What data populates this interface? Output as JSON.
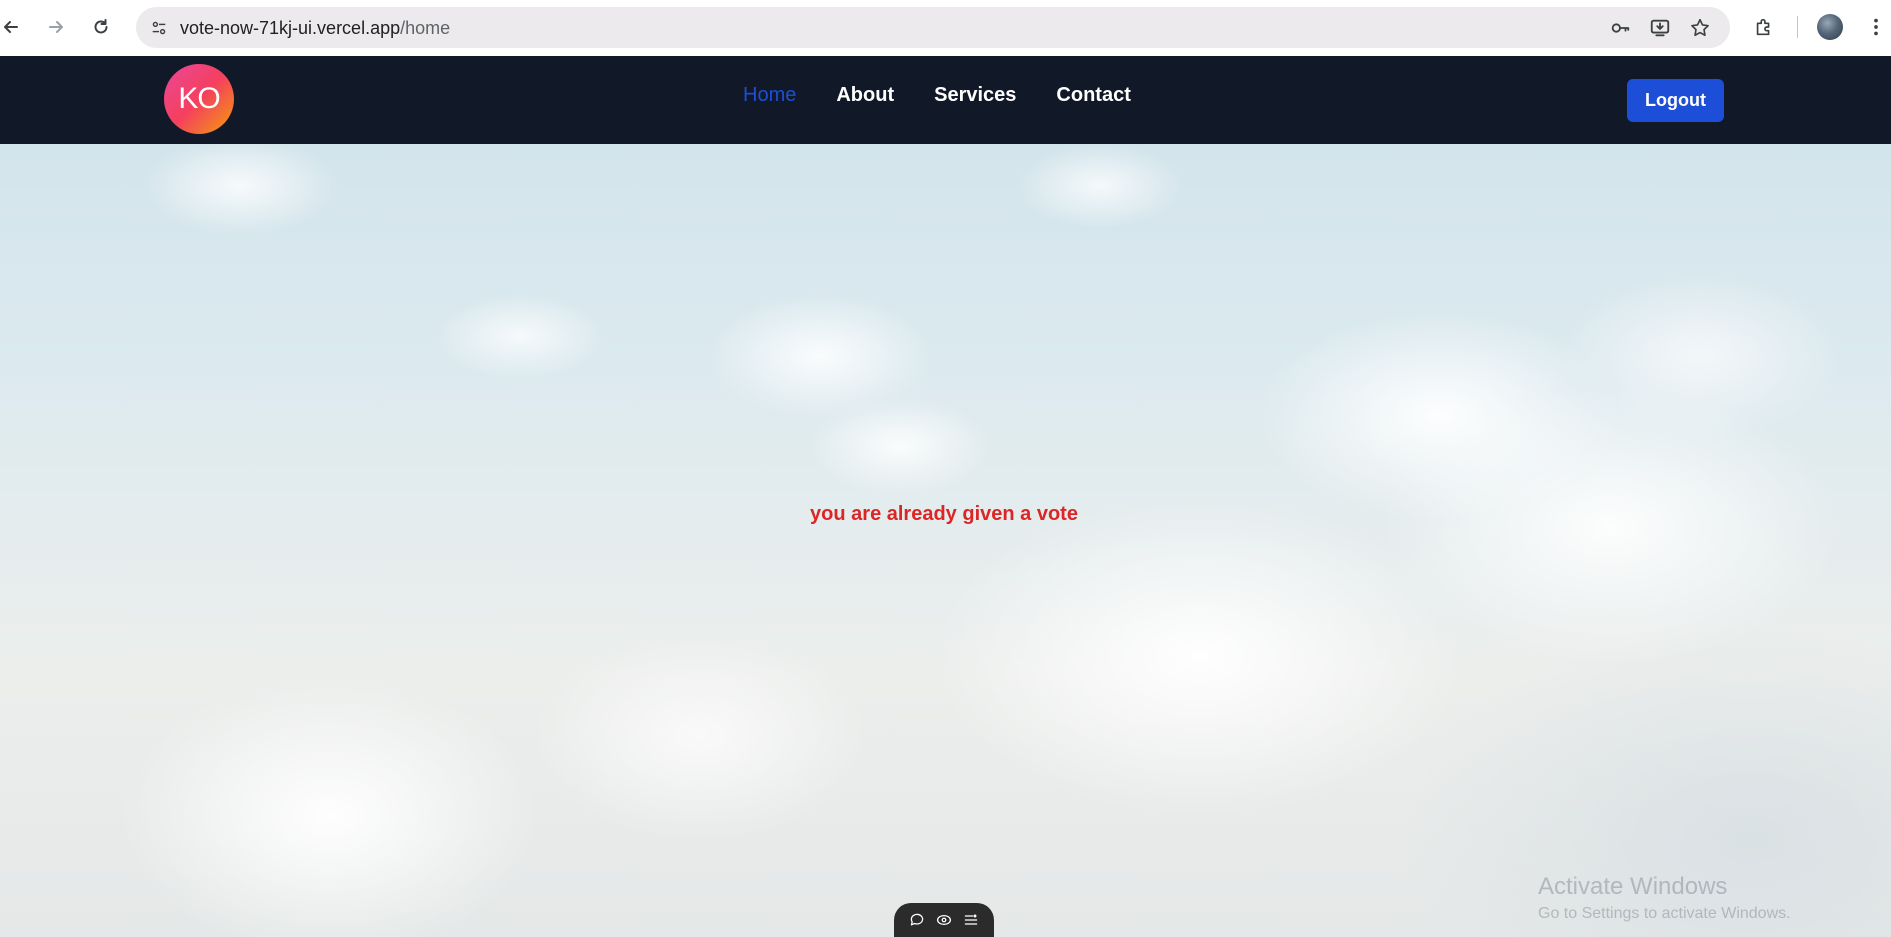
{
  "browser": {
    "url_host": "vote-now-71kj-ui.vercel.app",
    "url_path": "/home",
    "icons": {
      "back": "back-arrow-icon",
      "forward": "forward-arrow-icon",
      "reload": "reload-icon",
      "site_info": "site-settings-icon",
      "password": "key-icon",
      "install": "install-app-icon",
      "bookmark": "star-icon",
      "extensions": "puzzle-icon",
      "menu": "kebab-menu-icon"
    }
  },
  "site": {
    "logo_text": "KO",
    "nav": {
      "links": [
        {
          "label": "Home",
          "active": true
        },
        {
          "label": "About",
          "active": false
        },
        {
          "label": "Services",
          "active": false
        },
        {
          "label": "Contact",
          "active": false
        }
      ],
      "logout_label": "Logout"
    },
    "colors": {
      "navbar": "#111827",
      "active_link": "#1d4ed8",
      "logout_button": "#1d4ed8",
      "message": "#dc2626"
    }
  },
  "main": {
    "message": "you are already given a vote"
  },
  "toolbar": {
    "icons": [
      "chat-bubble-icon",
      "eye-icon",
      "list-settings-icon"
    ]
  },
  "watermark": {
    "title": "Activate Windows",
    "subtitle": "Go to Settings to activate Windows."
  }
}
